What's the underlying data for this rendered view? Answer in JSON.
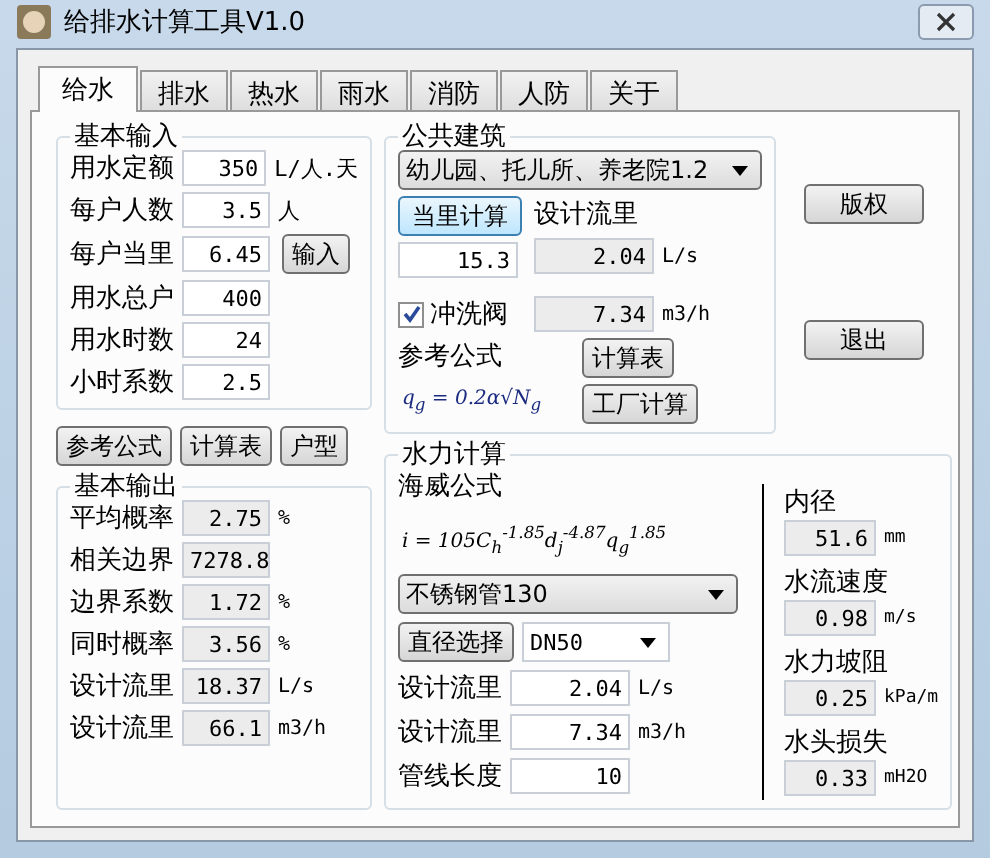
{
  "window": {
    "title": "给排水计算工具V1.0"
  },
  "tabs": [
    {
      "label": "给水",
      "selected": true
    },
    {
      "label": "排水",
      "selected": false
    },
    {
      "label": "热水",
      "selected": false
    },
    {
      "label": "雨水",
      "selected": false
    },
    {
      "label": "消防",
      "selected": false
    },
    {
      "label": "人防",
      "selected": false
    },
    {
      "label": "关于",
      "selected": false
    }
  ],
  "basic_input": {
    "title": "基本输入",
    "input_button": "输入",
    "rows": [
      {
        "label": "用水定额",
        "value": "350",
        "unit": "L/人.天",
        "readonly": false
      },
      {
        "label": "每户人数",
        "value": "3.5",
        "unit": "人",
        "readonly": false
      },
      {
        "label": "每户当里",
        "value": "6.45",
        "readonly": false
      },
      {
        "label": "用水总户",
        "value": "400",
        "readonly": false
      },
      {
        "label": "用水时数",
        "value": "24",
        "readonly": false
      },
      {
        "label": "小时系数",
        "value": "2.5",
        "readonly": false
      }
    ]
  },
  "public_building": {
    "title": "公共建筑",
    "dropdown": "幼儿园、托儿所、养老院1.2",
    "calc_button": "当里计算",
    "equiv_value": "15.3",
    "design_flow_label": "设计流里",
    "flow_ls": "2.04",
    "unit_ls": "L/s",
    "flush_valve": {
      "label": "冲洗阀",
      "checked": true
    },
    "flow_m3h": "7.34",
    "unit_m3h": "m3/h",
    "formula_label": "参考公式",
    "formula": "q$_{g}$ = 0.2α√N$_{g}$",
    "table_button": "计算表",
    "factory_button": "工厂计算"
  },
  "side_buttons": [
    "版权",
    "退出"
  ],
  "bottom_buttons": [
    "参考公式",
    "计算表",
    "户型"
  ],
  "basic_output": {
    "title": "基本输出",
    "rows": [
      {
        "label": "平均概率",
        "value": "2.75",
        "unit": "%",
        "readonly": true
      },
      {
        "label": "相关边界",
        "value": "7278.8",
        "readonly": true
      },
      {
        "label": "边界系数",
        "value": "1.72",
        "unit": "%",
        "readonly": true
      },
      {
        "label": "同时概率",
        "value": "3.56",
        "unit": "%",
        "readonly": true
      },
      {
        "label": "设计流里",
        "value": "18.37",
        "unit": "L/s",
        "readonly": true
      },
      {
        "label": "设计流里",
        "value": "66.1",
        "unit": "m3/h",
        "readonly": true
      }
    ]
  },
  "hydraulic": {
    "title": "水力计算",
    "formula_name": "海威公式",
    "formula": "i = 105C$_{h}$$^{-1.85}$d$_{j}$$^{-4.87}$q$_{g}$$^{1.85}$",
    "pipe_dropdown": "不锈钢管130",
    "diameter_button": "直径选择",
    "diameter_dropdown": "DN50",
    "rows": [
      {
        "label": "设计流里",
        "value": "2.04",
        "unit": "L/s",
        "readonly": false
      },
      {
        "label": "设计流里",
        "value": "7.34",
        "unit": "m3/h",
        "readonly": false
      },
      {
        "label": "管线长度",
        "value": "10",
        "readonly": false
      }
    ],
    "results": [
      {
        "label": "内径",
        "value": "51.6",
        "unit": "mm",
        "readonly": true
      },
      {
        "label": "水流速度",
        "value": "0.98",
        "unit": "m/s",
        "readonly": true
      },
      {
        "label": "水力坡阻",
        "value": "0.25",
        "unit": "kPa/m",
        "readonly": true
      },
      {
        "label": "水头损失",
        "value": "0.33",
        "unit": "mH2O",
        "readonly": true
      }
    ]
  }
}
